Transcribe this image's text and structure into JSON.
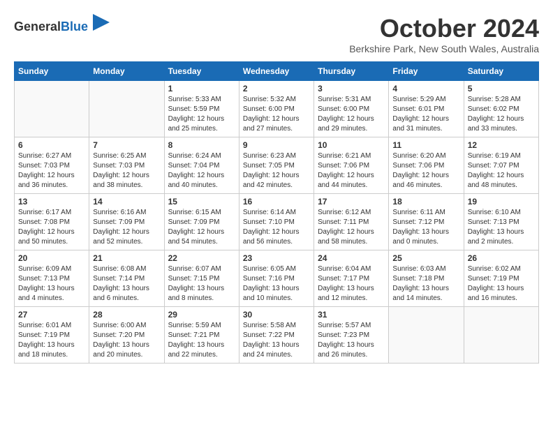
{
  "logo": {
    "general": "General",
    "blue": "Blue"
  },
  "title": "October 2024",
  "location": "Berkshire Park, New South Wales, Australia",
  "weekdays": [
    "Sunday",
    "Monday",
    "Tuesday",
    "Wednesday",
    "Thursday",
    "Friday",
    "Saturday"
  ],
  "weeks": [
    [
      {
        "day": "",
        "sunrise": "",
        "sunset": "",
        "daylight": ""
      },
      {
        "day": "",
        "sunrise": "",
        "sunset": "",
        "daylight": ""
      },
      {
        "day": "1",
        "sunrise": "Sunrise: 5:33 AM",
        "sunset": "Sunset: 5:59 PM",
        "daylight": "Daylight: 12 hours and 25 minutes."
      },
      {
        "day": "2",
        "sunrise": "Sunrise: 5:32 AM",
        "sunset": "Sunset: 6:00 PM",
        "daylight": "Daylight: 12 hours and 27 minutes."
      },
      {
        "day": "3",
        "sunrise": "Sunrise: 5:31 AM",
        "sunset": "Sunset: 6:00 PM",
        "daylight": "Daylight: 12 hours and 29 minutes."
      },
      {
        "day": "4",
        "sunrise": "Sunrise: 5:29 AM",
        "sunset": "Sunset: 6:01 PM",
        "daylight": "Daylight: 12 hours and 31 minutes."
      },
      {
        "day": "5",
        "sunrise": "Sunrise: 5:28 AM",
        "sunset": "Sunset: 6:02 PM",
        "daylight": "Daylight: 12 hours and 33 minutes."
      }
    ],
    [
      {
        "day": "6",
        "sunrise": "Sunrise: 6:27 AM",
        "sunset": "Sunset: 7:03 PM",
        "daylight": "Daylight: 12 hours and 36 minutes."
      },
      {
        "day": "7",
        "sunrise": "Sunrise: 6:25 AM",
        "sunset": "Sunset: 7:03 PM",
        "daylight": "Daylight: 12 hours and 38 minutes."
      },
      {
        "day": "8",
        "sunrise": "Sunrise: 6:24 AM",
        "sunset": "Sunset: 7:04 PM",
        "daylight": "Daylight: 12 hours and 40 minutes."
      },
      {
        "day": "9",
        "sunrise": "Sunrise: 6:23 AM",
        "sunset": "Sunset: 7:05 PM",
        "daylight": "Daylight: 12 hours and 42 minutes."
      },
      {
        "day": "10",
        "sunrise": "Sunrise: 6:21 AM",
        "sunset": "Sunset: 7:06 PM",
        "daylight": "Daylight: 12 hours and 44 minutes."
      },
      {
        "day": "11",
        "sunrise": "Sunrise: 6:20 AM",
        "sunset": "Sunset: 7:06 PM",
        "daylight": "Daylight: 12 hours and 46 minutes."
      },
      {
        "day": "12",
        "sunrise": "Sunrise: 6:19 AM",
        "sunset": "Sunset: 7:07 PM",
        "daylight": "Daylight: 12 hours and 48 minutes."
      }
    ],
    [
      {
        "day": "13",
        "sunrise": "Sunrise: 6:17 AM",
        "sunset": "Sunset: 7:08 PM",
        "daylight": "Daylight: 12 hours and 50 minutes."
      },
      {
        "day": "14",
        "sunrise": "Sunrise: 6:16 AM",
        "sunset": "Sunset: 7:09 PM",
        "daylight": "Daylight: 12 hours and 52 minutes."
      },
      {
        "day": "15",
        "sunrise": "Sunrise: 6:15 AM",
        "sunset": "Sunset: 7:09 PM",
        "daylight": "Daylight: 12 hours and 54 minutes."
      },
      {
        "day": "16",
        "sunrise": "Sunrise: 6:14 AM",
        "sunset": "Sunset: 7:10 PM",
        "daylight": "Daylight: 12 hours and 56 minutes."
      },
      {
        "day": "17",
        "sunrise": "Sunrise: 6:12 AM",
        "sunset": "Sunset: 7:11 PM",
        "daylight": "Daylight: 12 hours and 58 minutes."
      },
      {
        "day": "18",
        "sunrise": "Sunrise: 6:11 AM",
        "sunset": "Sunset: 7:12 PM",
        "daylight": "Daylight: 13 hours and 0 minutes."
      },
      {
        "day": "19",
        "sunrise": "Sunrise: 6:10 AM",
        "sunset": "Sunset: 7:13 PM",
        "daylight": "Daylight: 13 hours and 2 minutes."
      }
    ],
    [
      {
        "day": "20",
        "sunrise": "Sunrise: 6:09 AM",
        "sunset": "Sunset: 7:13 PM",
        "daylight": "Daylight: 13 hours and 4 minutes."
      },
      {
        "day": "21",
        "sunrise": "Sunrise: 6:08 AM",
        "sunset": "Sunset: 7:14 PM",
        "daylight": "Daylight: 13 hours and 6 minutes."
      },
      {
        "day": "22",
        "sunrise": "Sunrise: 6:07 AM",
        "sunset": "Sunset: 7:15 PM",
        "daylight": "Daylight: 13 hours and 8 minutes."
      },
      {
        "day": "23",
        "sunrise": "Sunrise: 6:05 AM",
        "sunset": "Sunset: 7:16 PM",
        "daylight": "Daylight: 13 hours and 10 minutes."
      },
      {
        "day": "24",
        "sunrise": "Sunrise: 6:04 AM",
        "sunset": "Sunset: 7:17 PM",
        "daylight": "Daylight: 13 hours and 12 minutes."
      },
      {
        "day": "25",
        "sunrise": "Sunrise: 6:03 AM",
        "sunset": "Sunset: 7:18 PM",
        "daylight": "Daylight: 13 hours and 14 minutes."
      },
      {
        "day": "26",
        "sunrise": "Sunrise: 6:02 AM",
        "sunset": "Sunset: 7:19 PM",
        "daylight": "Daylight: 13 hours and 16 minutes."
      }
    ],
    [
      {
        "day": "27",
        "sunrise": "Sunrise: 6:01 AM",
        "sunset": "Sunset: 7:19 PM",
        "daylight": "Daylight: 13 hours and 18 minutes."
      },
      {
        "day": "28",
        "sunrise": "Sunrise: 6:00 AM",
        "sunset": "Sunset: 7:20 PM",
        "daylight": "Daylight: 13 hours and 20 minutes."
      },
      {
        "day": "29",
        "sunrise": "Sunrise: 5:59 AM",
        "sunset": "Sunset: 7:21 PM",
        "daylight": "Daylight: 13 hours and 22 minutes."
      },
      {
        "day": "30",
        "sunrise": "Sunrise: 5:58 AM",
        "sunset": "Sunset: 7:22 PM",
        "daylight": "Daylight: 13 hours and 24 minutes."
      },
      {
        "day": "31",
        "sunrise": "Sunrise: 5:57 AM",
        "sunset": "Sunset: 7:23 PM",
        "daylight": "Daylight: 13 hours and 26 minutes."
      },
      {
        "day": "",
        "sunrise": "",
        "sunset": "",
        "daylight": ""
      },
      {
        "day": "",
        "sunrise": "",
        "sunset": "",
        "daylight": ""
      }
    ]
  ]
}
